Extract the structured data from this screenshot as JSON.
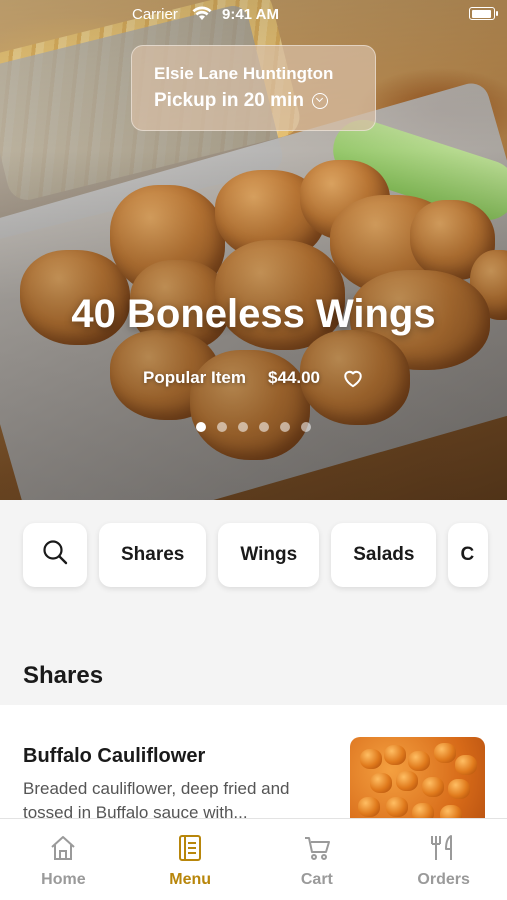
{
  "status_bar": {
    "carrier": "Carrier",
    "time": "9:41 AM",
    "battery_level": 0.95
  },
  "location": {
    "name": "Elsie Lane Huntington",
    "pickup": "Pickup in 20 min"
  },
  "hero": {
    "title": "40 Boneless Wings",
    "badge": "Popular Item",
    "price": "$44.00",
    "carousel_count": 6,
    "carousel_active": 0
  },
  "categories": {
    "search_icon": "search-icon",
    "items": [
      "Shares",
      "Wings",
      "Salads",
      "C"
    ]
  },
  "section": {
    "title": "Shares"
  },
  "menu_item": {
    "name": "Buffalo Cauliflower",
    "description": "Breaded cauliflower, deep fried and tossed in Buffalo sauce with..."
  },
  "tabbar": {
    "items": [
      {
        "label": "Home",
        "icon": "home-icon"
      },
      {
        "label": "Menu",
        "icon": "menu-icon"
      },
      {
        "label": "Cart",
        "icon": "cart-icon"
      },
      {
        "label": "Orders",
        "icon": "orders-icon"
      }
    ],
    "active": "Menu"
  },
  "colors": {
    "accent": "#b8860b",
    "inactive": "#9a9a9a",
    "background": "#f4f4f4"
  }
}
